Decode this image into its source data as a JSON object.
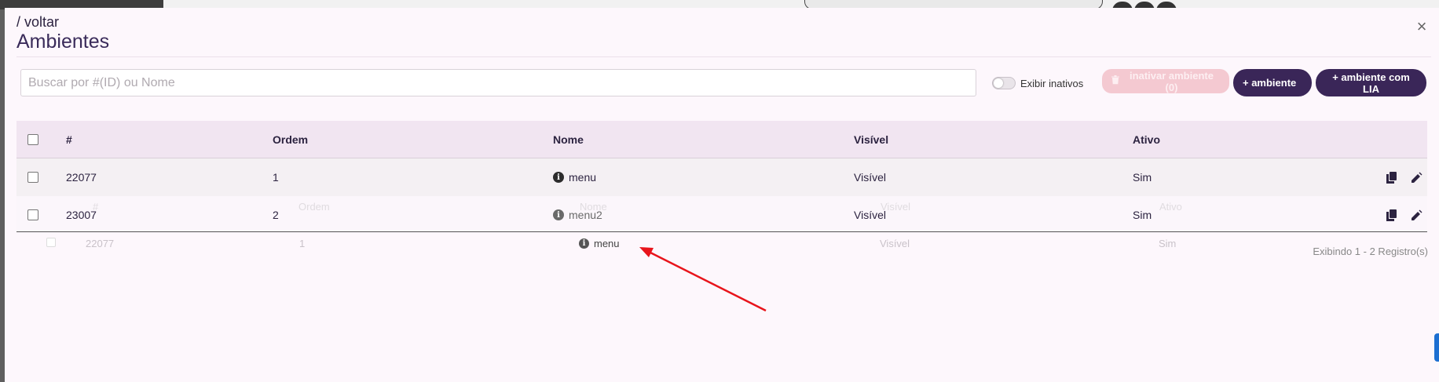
{
  "header": {
    "back_label": "/ voltar",
    "title": "Ambientes",
    "close_glyph": "×"
  },
  "toolbar": {
    "search_placeholder": "Buscar por #(ID) ou Nome",
    "search_value": "",
    "toggle_label": "Exibir inativos",
    "toggle_on": false,
    "inactivate_label": "inativar ambiente (0)",
    "add_label": "+ ambiente",
    "add_lia_label": "+ ambiente com LIA"
  },
  "table": {
    "columns": [
      "#",
      "Ordem",
      "Nome",
      "Visível",
      "Ativo"
    ],
    "rows": [
      {
        "id": "22077",
        "ordem": "1",
        "nome": "menu",
        "visivel": "Visível",
        "ativo": "Sim"
      },
      {
        "id": "23007",
        "ordem": "2",
        "nome": "menu2",
        "visivel": "Visível",
        "ativo": "Sim"
      }
    ],
    "drag_preview": {
      "id": "22077",
      "ordem": "1",
      "nome": "menu",
      "visivel": "Visível",
      "ativo": "Sim"
    },
    "footer": "Exibindo 1 - 2 Registro(s)"
  },
  "icons": {
    "copy": "copy-icon",
    "edit": "pencil-icon",
    "info": "info-circle-icon",
    "trash": "trash-icon"
  },
  "colors": {
    "primary": "#3a2658",
    "disabled_button": "#f4c9d1",
    "header_bg": "#f1e5f1",
    "annotation_arrow": "#e8141b"
  }
}
